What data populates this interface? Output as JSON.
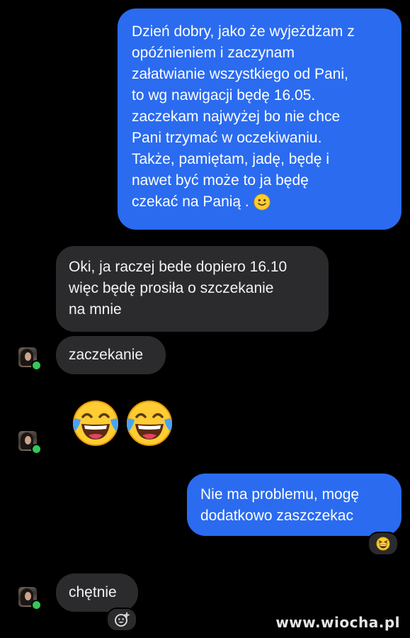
{
  "messages": {
    "m1": {
      "direction": "outgoing",
      "lines": [
        "Dzień dobry, jako że wyjeżdżam z",
        "opóźnieniem i zaczynam",
        "załatwianie wszystkiego od Pani,",
        "to wg nawigacji będę 16.05.",
        "zaczekam najwyżej bo nie chce",
        "Pani trzymać w oczekiwaniu.",
        "Także, pamiętam, jadę, będę i",
        "nawet być może to ja będę",
        "czekać na Panią ."
      ],
      "trailing_emoji": "slightly-smiling-face"
    },
    "m2": {
      "direction": "incoming",
      "lines": [
        "Oki, ja raczej bede dopiero 16.10",
        "więc będę prosiła o szczekanie",
        "na mnie"
      ]
    },
    "m3": {
      "direction": "incoming",
      "lines": [
        "zaczekanie"
      ]
    },
    "m4": {
      "direction": "incoming",
      "emojis": [
        "face-with-tears-of-joy",
        "face-with-tears-of-joy"
      ]
    },
    "m5": {
      "direction": "outgoing",
      "lines": [
        "Nie ma problemu, mogę",
        "dodatkowo zaszczekac"
      ],
      "reaction": "grinning-squinting-face"
    },
    "m6": {
      "direction": "incoming",
      "lines": [
        "chętnie"
      ],
      "reaction": "add-reaction-icon"
    }
  },
  "watermark": "www.wiocha.pl",
  "colors": {
    "background": "#000000",
    "outgoing_bubble": "#2a6bf0",
    "incoming_bubble": "#2b2b2d",
    "online_dot": "#35c759"
  }
}
